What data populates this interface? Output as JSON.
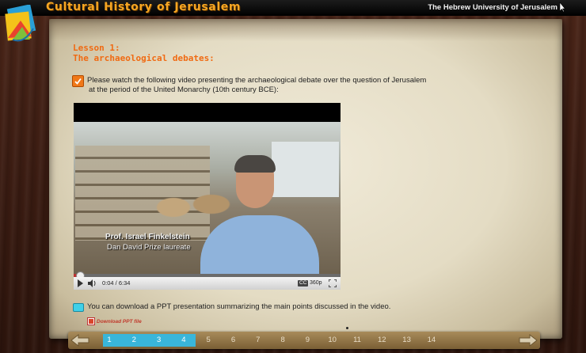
{
  "app": {
    "title": "Cultural History of Jerusalem",
    "university": "The Hebrew University of Jerusalem"
  },
  "lesson": {
    "line1": "Lesson 1:",
    "line2": "The archaeological debates:"
  },
  "intro": {
    "line1": "Please watch the following video presenting the archaeological debate over the question of Jerusalem",
    "line2": "at the period of the United Monarchy (10th century BCE):"
  },
  "video": {
    "caption_name": "Prof. Israel Finkelstein",
    "caption_title": "Dan David Prize laureate",
    "time": "0:04 / 6:34",
    "cc_label": "CC",
    "quality": "360p",
    "progress_fraction": 0.011
  },
  "download": {
    "text": "You can download a PPT presentation summarizing the main points discussed in the video.",
    "link_label": "Download PPT file"
  },
  "pagination": {
    "pages": [
      "1",
      "2",
      "3",
      "4",
      "5",
      "6",
      "7",
      "8",
      "9",
      "10",
      "11",
      "12",
      "13",
      "14"
    ],
    "completed_count": 4
  },
  "colors": {
    "title": "#f5a623",
    "lesson": "#f06a12",
    "completed": "#39b6da"
  }
}
